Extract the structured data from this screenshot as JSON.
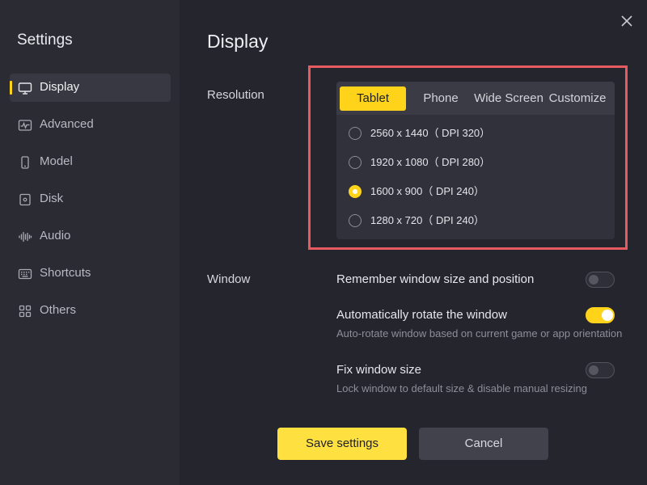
{
  "sidebar": {
    "title": "Settings",
    "items": [
      {
        "label": "Display",
        "icon": "monitor-icon",
        "active": true
      },
      {
        "label": "Advanced",
        "icon": "pulse-icon",
        "active": false
      },
      {
        "label": "Model",
        "icon": "phone-icon",
        "active": false
      },
      {
        "label": "Disk",
        "icon": "disk-icon",
        "active": false
      },
      {
        "label": "Audio",
        "icon": "audio-wave-icon",
        "active": false
      },
      {
        "label": "Shortcuts",
        "icon": "keyboard-icon",
        "active": false
      },
      {
        "label": "Others",
        "icon": "grid-icon",
        "active": false
      }
    ]
  },
  "main": {
    "title": "Display",
    "resolution": {
      "label": "Resolution",
      "tabs": [
        "Tablet",
        "Phone",
        "Wide Screen",
        "Customize"
      ],
      "active_tab": "Tablet",
      "options": [
        {
          "label": "2560 x 1440（ DPI 320）",
          "checked": false
        },
        {
          "label": "1920 x 1080（ DPI 280）",
          "checked": false
        },
        {
          "label": "1600 x 900（ DPI 240）",
          "checked": true
        },
        {
          "label": "1280 x 720（ DPI 240）",
          "checked": false
        }
      ]
    },
    "window": {
      "label": "Window",
      "options": [
        {
          "title": "Remember window size and position",
          "desc": "",
          "on": false
        },
        {
          "title": "Automatically rotate the window",
          "desc": "Auto-rotate window based on current game or app orientation",
          "on": true
        },
        {
          "title": "Fix window size",
          "desc": "Lock window to default size & disable manual resizing",
          "on": false
        }
      ]
    }
  },
  "buttons": {
    "save": "Save settings",
    "cancel": "Cancel"
  },
  "colors": {
    "accent": "#ffd31a",
    "highlight_border": "#e75a60",
    "background": "#24252d",
    "sidebar": "#2a2b33"
  }
}
